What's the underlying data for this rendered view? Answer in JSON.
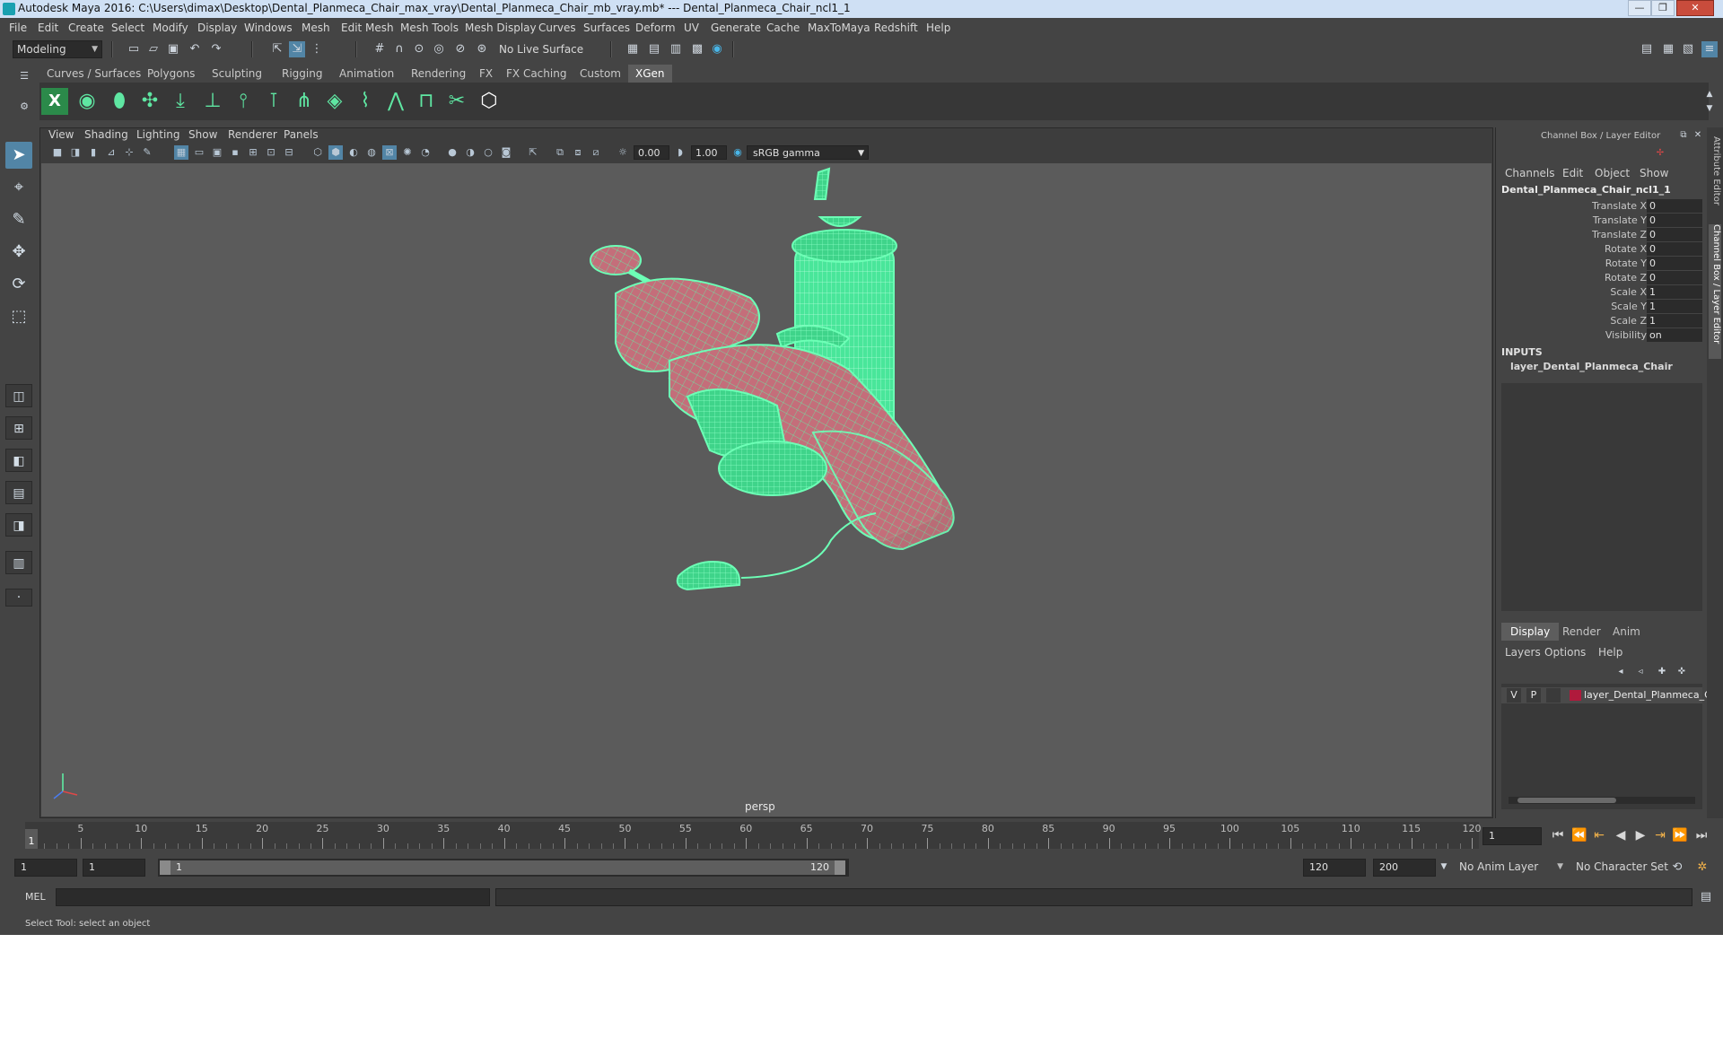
{
  "window": {
    "title": "Autodesk Maya 2016: C:\\Users\\dimax\\Desktop\\Dental_Planmeca_Chair_max_vray\\Dental_Planmeca_Chair_mb_vray.mb*   ---   Dental_Planmeca_Chair_ncl1_1",
    "minimize": "—",
    "maximize": "❐",
    "close": "✕"
  },
  "menu": [
    "File",
    "Edit",
    "Create",
    "Select",
    "Modify",
    "Display",
    "Windows",
    "Mesh",
    "Edit Mesh",
    "Mesh Tools",
    "Mesh Display",
    "Curves",
    "Surfaces",
    "Deform",
    "UV",
    "Generate",
    "Cache",
    "MaxToMaya",
    "Redshift",
    "Help"
  ],
  "status": {
    "mode": "Modeling",
    "live_surface": "No Live Surface"
  },
  "shelf": {
    "tabs": [
      "Curves / Surfaces",
      "Polygons",
      "Sculpting",
      "Rigging",
      "Animation",
      "Rendering",
      "FX",
      "FX Caching",
      "Custom",
      "XGen"
    ],
    "active_tab": "XGen"
  },
  "viewport": {
    "menu": [
      "View",
      "Shading",
      "Lighting",
      "Show",
      "Renderer",
      "Panels"
    ],
    "exposure": "0.00",
    "gamma": "1.00",
    "color_space": "sRGB gamma",
    "camera": "persp"
  },
  "channel_box": {
    "title": "Channel Box / Layer Editor",
    "menu": [
      "Channels",
      "Edit",
      "Object",
      "Show"
    ],
    "object": "Dental_Planmeca_Chair_ncl1_1",
    "channels": [
      {
        "label": "Translate X",
        "value": "0"
      },
      {
        "label": "Translate Y",
        "value": "0"
      },
      {
        "label": "Translate Z",
        "value": "0"
      },
      {
        "label": "Rotate X",
        "value": "0"
      },
      {
        "label": "Rotate Y",
        "value": "0"
      },
      {
        "label": "Rotate Z",
        "value": "0"
      },
      {
        "label": "Scale X",
        "value": "1"
      },
      {
        "label": "Scale Y",
        "value": "1"
      },
      {
        "label": "Scale Z",
        "value": "1"
      },
      {
        "label": "Visibility",
        "value": "on"
      }
    ],
    "inputs_header": "INPUTS",
    "input_item": "layer_Dental_Planmeca_Chair"
  },
  "layer_editor": {
    "tabs": [
      "Display",
      "Render",
      "Anim"
    ],
    "active_tab": "Display",
    "menu": [
      "Layers",
      "Options",
      "Help"
    ],
    "layer": {
      "v": "V",
      "p": "P",
      "name": "layer_Dental_Planmeca_C",
      "color": "#b01a3c"
    }
  },
  "side_tabs": [
    "Attribute Editor",
    "Channel Box / Layer Editor"
  ],
  "timeline": {
    "current_frame": "1",
    "ticks": [
      "5",
      "10",
      "15",
      "20",
      "25",
      "30",
      "35",
      "40",
      "45",
      "50",
      "55",
      "60",
      "65",
      "70",
      "75",
      "80",
      "85",
      "90",
      "95",
      "100",
      "105",
      "110",
      "115",
      "120"
    ],
    "current_frame_field": "1"
  },
  "range": {
    "start": "1",
    "playback_start": "1",
    "slider_start": "1",
    "slider_end": "120",
    "playback_end": "120",
    "end": "200",
    "anim_layer": "No Anim Layer",
    "character_set": "No Character Set"
  },
  "command": {
    "label": "MEL"
  },
  "help_line": "Select Tool: select an object",
  "colors": {
    "wireframe": "#5ff5a8",
    "surface": "#c46e7a",
    "viewport_bg": "#5b5b5b"
  }
}
